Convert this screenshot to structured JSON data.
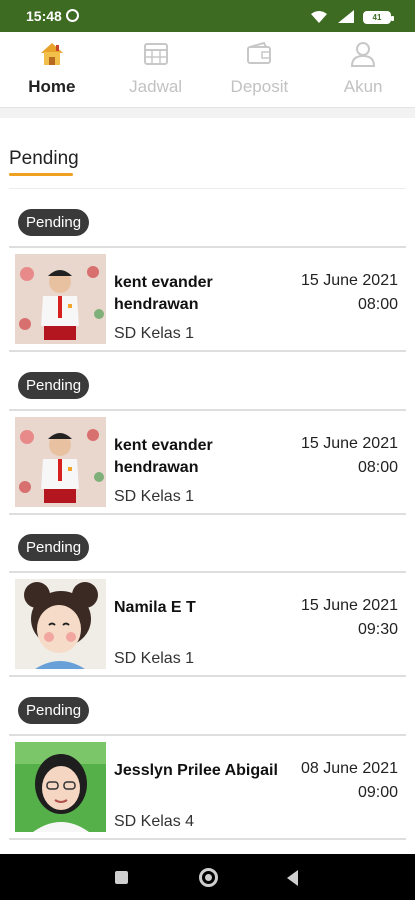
{
  "status_bar": {
    "time": "15:48",
    "battery": "41"
  },
  "tabs": [
    {
      "label": "Home",
      "active": true,
      "icon": "house-icon"
    },
    {
      "label": "Jadwal",
      "active": false,
      "icon": "calendar-grid-icon"
    },
    {
      "label": "Deposit",
      "active": false,
      "icon": "wallet-icon"
    },
    {
      "label": "Akun",
      "active": false,
      "icon": "person-icon"
    }
  ],
  "section": {
    "title": "Pending"
  },
  "schedules": [
    {
      "status": "Pending",
      "name": "kent evander hendrawan",
      "grade": "SD Kelas 1",
      "date": "15 June 2021",
      "time": "08:00",
      "photo": "student-boy-photo"
    },
    {
      "status": "Pending",
      "name": "kent evander hendrawan",
      "grade": "SD Kelas 1",
      "date": "15 June 2021",
      "time": "08:00",
      "photo": "student-boy-photo"
    },
    {
      "status": "Pending",
      "name": "Namila E T",
      "grade": "SD Kelas 1",
      "date": "15 June 2021",
      "time": "09:30",
      "photo": "cartoon-avatar-photo"
    },
    {
      "status": "Pending",
      "name": "Jesslyn Prilee Abigail",
      "grade": "SD Kelas 4",
      "date": "08 June 2021",
      "time": "09:00",
      "photo": "student-girl-photo"
    }
  ],
  "colors": {
    "status_bar": "#3d6b22",
    "accent_underline": "#f0a020",
    "badge": "#3a3a3a",
    "home_icon": "#e8a22a"
  }
}
